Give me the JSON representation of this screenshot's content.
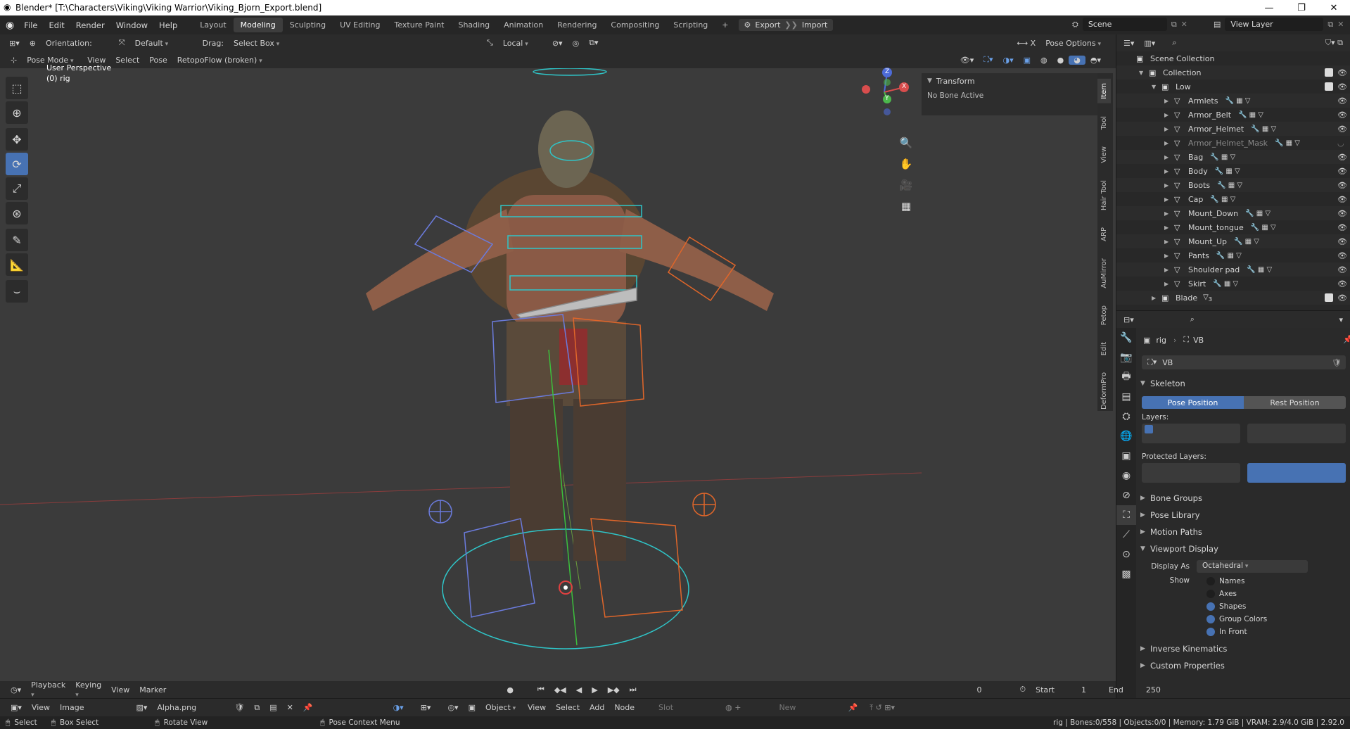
{
  "window": {
    "title": "Blender* [T:\\Characters\\Viking\\Viking Warrior\\Viking_Bjorn_Export.blend]",
    "minimize": "—",
    "maximize": "❐",
    "close": "✕"
  },
  "menu": [
    "File",
    "Edit",
    "Render",
    "Window",
    "Help"
  ],
  "workspaces": [
    {
      "label": "Layout",
      "active": false
    },
    {
      "label": "Modeling",
      "active": true
    },
    {
      "label": "Sculpting",
      "active": false
    },
    {
      "label": "UV Editing",
      "active": false
    },
    {
      "label": "Texture Paint",
      "active": false
    },
    {
      "label": "Shading",
      "active": false
    },
    {
      "label": "Animation",
      "active": false
    },
    {
      "label": "Rendering",
      "active": false
    },
    {
      "label": "Compositing",
      "active": false
    },
    {
      "label": "Scripting",
      "active": false
    }
  ],
  "addons": {
    "export": "Export",
    "import": "Import"
  },
  "scene": {
    "name": "Scene",
    "view_layer": "View Layer"
  },
  "vheader": {
    "orientation_label": "Orientation:",
    "orientation_value": "Default",
    "drag_label": "Drag:",
    "drag_value": "Select Box",
    "pivot": "Local",
    "pose_options": "Pose Options"
  },
  "vheader2": {
    "mode": "Pose Mode",
    "menus": [
      "View",
      "Select",
      "Pose"
    ],
    "addon": "RetopoFlow (broken)"
  },
  "viewport": {
    "perspective": "User Perspective",
    "object": "(0) rig",
    "gizmo_axes": {
      "z": "Z",
      "x": "X",
      "y": "Y"
    }
  },
  "npanel": {
    "section": "Transform",
    "message": "No Bone Active",
    "tabs": [
      "Item",
      "Tool",
      "View",
      "Hair Tool",
      "ARP",
      "AuMirror",
      "Petop",
      "Edit",
      "DeformPro"
    ]
  },
  "outliner": {
    "root": "Scene Collection",
    "collection": "Collection",
    "low": "Low",
    "items": [
      "Armlets",
      "Armor_Belt",
      "Armor_Helmet",
      "Armor_Helmet_Mask",
      "Bag",
      "Body",
      "Boots",
      "Cap",
      "Mount_Down",
      "Mount_tongue",
      "Mount_Up",
      "Pants",
      "Shoulder pad",
      "Skirt"
    ],
    "blade": "Blade",
    "blade_count": "3"
  },
  "properties": {
    "object": "rig",
    "data": "VB",
    "datablock": "VB",
    "skeleton": "Skeleton",
    "pose_position": "Pose Position",
    "rest_position": "Rest Position",
    "layers": "Layers:",
    "protected_layers": "Protected Layers:",
    "sections": [
      "Bone Groups",
      "Pose Library",
      "Motion Paths"
    ],
    "viewport_display": "Viewport Display",
    "display_as_label": "Display As",
    "display_as_value": "Octahedral",
    "show_label": "Show",
    "show_items": [
      {
        "label": "Names",
        "checked": false
      },
      {
        "label": "Axes",
        "checked": false
      },
      {
        "label": "Shapes",
        "checked": true
      },
      {
        "label": "Group Colors",
        "checked": true
      },
      {
        "label": "In Front",
        "checked": true
      }
    ],
    "bottom_sections": [
      "Inverse Kinematics",
      "Custom Properties"
    ]
  },
  "timeline": {
    "menus": [
      "Playback",
      "Keying",
      "View",
      "Marker"
    ],
    "current": "0",
    "start_label": "Start",
    "start": "1",
    "end_label": "End",
    "end": "250"
  },
  "imgeditor": {
    "menus": [
      "View",
      "Image"
    ],
    "image": "Alpha.png",
    "object": "Object",
    "node_menus": [
      "View",
      "Select",
      "Add",
      "Node"
    ],
    "slot": "Slot",
    "new": "New"
  },
  "status": {
    "select": "Select",
    "box_select": "Box Select",
    "rotate": "Rotate View",
    "context": "Pose Context Menu",
    "stats": "rig | Bones:0/558 | Objects:0/0 | Memory: 1.79 GiB | VRAM: 2.9/4.0 GiB | 2.92.0"
  },
  "colors": {
    "accent": "#4772b3",
    "viewport_bg": "#3b3b3b",
    "panel": "#2b2b2b",
    "bone_cyan": "#2fc5c8",
    "bone_orange": "#e0662a",
    "bone_blue": "#6b7bdc"
  }
}
